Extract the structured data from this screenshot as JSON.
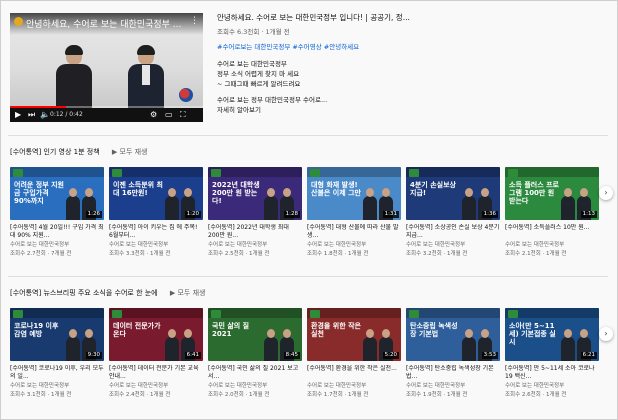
{
  "featured": {
    "title": "안녕하세요, 수어로 보는 대한민국정부 ...",
    "time": "0:12 / 0:42",
    "progress": 0.29,
    "desc_title": "안녕하세요. 수어로 보는 대한민국정부 입니다! | 공공기, 정...",
    "meta": "조회수 6.3천회 · 1개월 전",
    "link": "#수어로보는 대한민국정부 #수어영상 #안녕하세요",
    "lines": [
      "수어로 보는 대한민국정부",
      "정부 소식 어렵게 찾지 마 세요",
      "~ 그때그때 빠르게 알려드려요"
    ],
    "lines2": [
      "수어로 보는 정부 대한민국정부 수어로...",
      "자세히 알아보기"
    ]
  },
  "shelf1": {
    "title": "[수어통역] 인기 영상 1분 정책",
    "play_all": "▶ 모두 재생",
    "cards": [
      {
        "cap": "어려운 정부 지원금 구입가격 90%까지",
        "dur": "1:26",
        "bg": "#2a6fbf",
        "title": "[수어통역] 4월 20일!!! 구입 가격 최대 90% 지원...",
        "ch": "수어로 보는 대한민국정부",
        "views": "조회수 2.7천회 · 7개월 전"
      },
      {
        "cap": "이젠 소득분위 최대 16만원!",
        "dur": "1:20",
        "bg": "#1b3f8c",
        "title": "[수어통역] 아이 키우는 집 에 주목! 6월부터...",
        "ch": "수어로 보는 대한민국정부",
        "views": "조회수 3.3천회 · 1개월 전"
      },
      {
        "cap": "2022년 대학생 200만 원 받는다!",
        "dur": "1:28",
        "bg": "#3b2a7a",
        "title": "[수어통역] 2022년 대학생 최대 200만 원...",
        "ch": "수어로 보는 대한민국정부",
        "views": "조회수 2.5천회 · 1개월 전"
      },
      {
        "cap": "대형 화재 발생! 산불은 이제 그만",
        "dur": "1:31",
        "bg": "#4a8ac9",
        "title": "[수어통역] 대형 산불에 따라 산불 발생...",
        "ch": "수어로 보는 대한민국정부",
        "views": "조회수 1.8천회 · 1개월 전"
      },
      {
        "cap": "4분기 손실보상 지급!",
        "dur": "1:36",
        "bg": "#1e3a78",
        "title": "[수어통역] 소상공인 손실 보상 4분기 지급...",
        "ch": "수어로 보는 대한민국정부",
        "views": "조회수 3.2천회 · 1개월 전"
      },
      {
        "cap": "소득 플러스 프로그램 100만 원 받는다",
        "dur": "1:13",
        "bg": "#2c8a3e",
        "title": "[수어통역] 소득플러스 10만 원...",
        "ch": "수어로 보는 대한민국정부",
        "views": "조회수 2.1천회 · 1개월 전"
      }
    ]
  },
  "shelf2": {
    "title": "[수어통역] 뉴스브리핑 주요 소식을 수어로 한 눈에",
    "play_all": "▶ 모두 재생",
    "cards": [
      {
        "cap": "코로나19 이후 감염 예방",
        "dur": "9:30",
        "bg": "#183a6e",
        "title": "[수어통역] 코로나19 이후, 우리 모두의 일...",
        "ch": "수어로 보는 대한민국정부",
        "views": "조회수 3.1천회 · 1개월 전"
      },
      {
        "cap": "데이터 전문가가 온다",
        "dur": "6:41",
        "bg": "#7a1a2e",
        "title": "[수어통역] 데이터 전문가 기본 교육 안내...",
        "ch": "수어로 보는 대한민국정부",
        "views": "조회수 2.4천회 · 1개월 전"
      },
      {
        "cap": "국민 삶의 질 2021",
        "dur": "8:45",
        "bg": "#2b6b2f",
        "title": "[수어통역] 국민 삶의 질 2021 보고서...",
        "ch": "수어로 보는 대한민국정부",
        "views": "조회수 2.0천회 · 1개월 전"
      },
      {
        "cap": "환경을 위한 작은 실천",
        "dur": "5:20",
        "bg": "#8a2b2b",
        "title": "[수어통역] 환경을 위한 작은 실천...",
        "ch": "수어로 보는 대한민국정부",
        "views": "조회수 1.7천회 · 1개월 전"
      },
      {
        "cap": "탄소중립 녹색성장 기본법",
        "dur": "3:53",
        "bg": "#2f5f9a",
        "title": "[수어통역] 탄소중립 녹색성장 기본법...",
        "ch": "수어로 보는 대한민국정부",
        "views": "조회수 1.9천회 · 1개월 전"
      },
      {
        "cap": "소아(만 5~11세) 기본접종 실시",
        "dur": "6:21",
        "bg": "#1b4f8a",
        "title": "[수어통역] 만 5~11세 소아 코로나19 백신...",
        "ch": "수어로 보는 대한민국정부",
        "views": "조회수 2.6천회 · 1개월 전"
      }
    ]
  },
  "ui": {
    "next_glyph": "›"
  }
}
